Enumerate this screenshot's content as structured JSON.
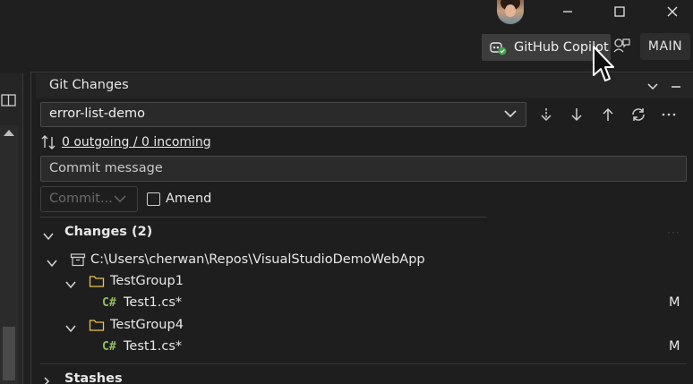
{
  "titlebar": {
    "copilot_label": "GitHub Copilot",
    "branch_badge": "MAIN"
  },
  "panel": {
    "title": "Git Changes",
    "branch": "error-list-demo",
    "sync_status": "0 outgoing / 0 incoming",
    "commit_placeholder": "Commit message",
    "commit_button": "Commit...",
    "amend_label": "Amend"
  },
  "changes": {
    "header": "Changes (2)",
    "repo_path": "C:\\Users\\cherwan\\Repos\\VisualStudioDemoWebApp",
    "groups": [
      {
        "name": "TestGroup1",
        "file_lang": "C#",
        "file": "Test1.cs*",
        "status": "M"
      },
      {
        "name": "TestGroup4",
        "file_lang": "C#",
        "file": "Test1.cs*",
        "status": "M"
      }
    ]
  },
  "stashes": {
    "header": "Stashes"
  },
  "colors": {
    "background": "#1f1f1f",
    "copilot_button": "#3d3d3d",
    "csharp_icon": "#8fbf5f",
    "folder_icon": "#e8c34f"
  }
}
